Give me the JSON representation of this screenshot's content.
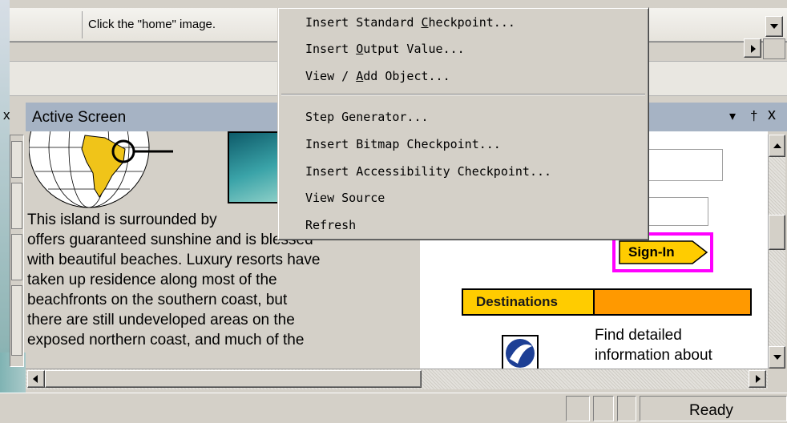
{
  "toolbar": {
    "step_text": "Click the \"home\" image."
  },
  "panel": {
    "title": "Active Screen",
    "close_glyph": "x",
    "pin_glyph": "†",
    "dropdown_glyph": "▾"
  },
  "page": {
    "paragraph_lines": [
      "This island is surrounded by",
      "offers guaranteed sunshine and is blessed",
      "with beautiful beaches. Luxury resorts have",
      "taken up residence along most of the",
      "beachfronts on the southern coast, but",
      "there are still undeveloped areas on the",
      "exposed northern coast, and much of the"
    ],
    "signin_label": "Sign-In",
    "destinations_label": "Destinations",
    "find_lines": [
      "Find detailed",
      "information about"
    ]
  },
  "context_menu": {
    "items": [
      {
        "pre": "Insert Standard ",
        "key": "C",
        "post": "heckpoint..."
      },
      {
        "pre": "Insert ",
        "key": "O",
        "post": "utput Value..."
      },
      {
        "pre": "View / ",
        "key": "A",
        "post": "dd Object..."
      },
      {
        "pre": "Step Generator...",
        "key": "",
        "post": ""
      },
      {
        "pre": "Insert Bitmap Checkpoint...",
        "key": "",
        "post": ""
      },
      {
        "pre": "Insert Accessibility Checkpoint...",
        "key": "",
        "post": ""
      },
      {
        "pre": "View Source",
        "key": "",
        "post": ""
      },
      {
        "pre": "Refresh",
        "key": "",
        "post": ""
      }
    ]
  },
  "status_bar": {
    "status_text": "Ready"
  },
  "colors": {
    "title_bar": "#a6b3c4",
    "signin_highlight": "#ff00ff",
    "signin_bg": "#ffcc00",
    "destinations_bg": "#ff9900",
    "page_bg": "#ffffff"
  }
}
